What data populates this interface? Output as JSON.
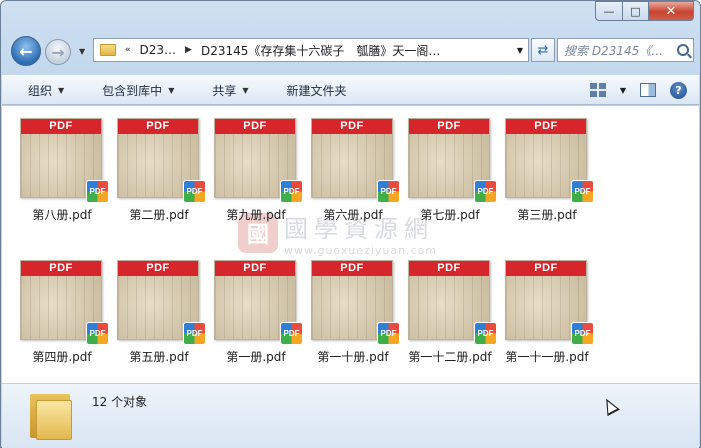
{
  "window": {
    "minimize_icon": "minimize-icon",
    "maximize_icon": "maximize-icon",
    "close_icon": "close-icon",
    "min_glyph": "—",
    "max_glyph": "□",
    "close_glyph": "✕"
  },
  "nav": {
    "address_prefix": "«",
    "crumb1": "D23…",
    "crumb2": "D23145《存存集十六碳子　瓠膳》天一阁…",
    "search_placeholder": "搜索 D23145《…"
  },
  "toolbar": {
    "organize": "组织",
    "include_in_library": "包含到库中",
    "share": "共享",
    "new_folder": "新建文件夹"
  },
  "files": [
    {
      "name": "第八册.pdf"
    },
    {
      "name": "第二册.pdf"
    },
    {
      "name": "第九册.pdf"
    },
    {
      "name": "第六册.pdf"
    },
    {
      "name": "第七册.pdf"
    },
    {
      "name": "第三册.pdf"
    },
    {
      "name": "第四册.pdf"
    },
    {
      "name": "第五册.pdf"
    },
    {
      "name": "第一册.pdf"
    },
    {
      "name": "第一十册.pdf"
    },
    {
      "name": "第一十二册.pdf"
    },
    {
      "name": "第一十一册.pdf"
    }
  ],
  "thumb_band": "PDF",
  "badge": "PDF",
  "watermark": {
    "seal": "國",
    "title": "國學資源網",
    "url": "www.guoxueziyuan.com"
  },
  "status": {
    "count": "12 个对象"
  },
  "colors": {
    "pdf_red": "#d7262b",
    "accent": "#2c6cb3"
  }
}
